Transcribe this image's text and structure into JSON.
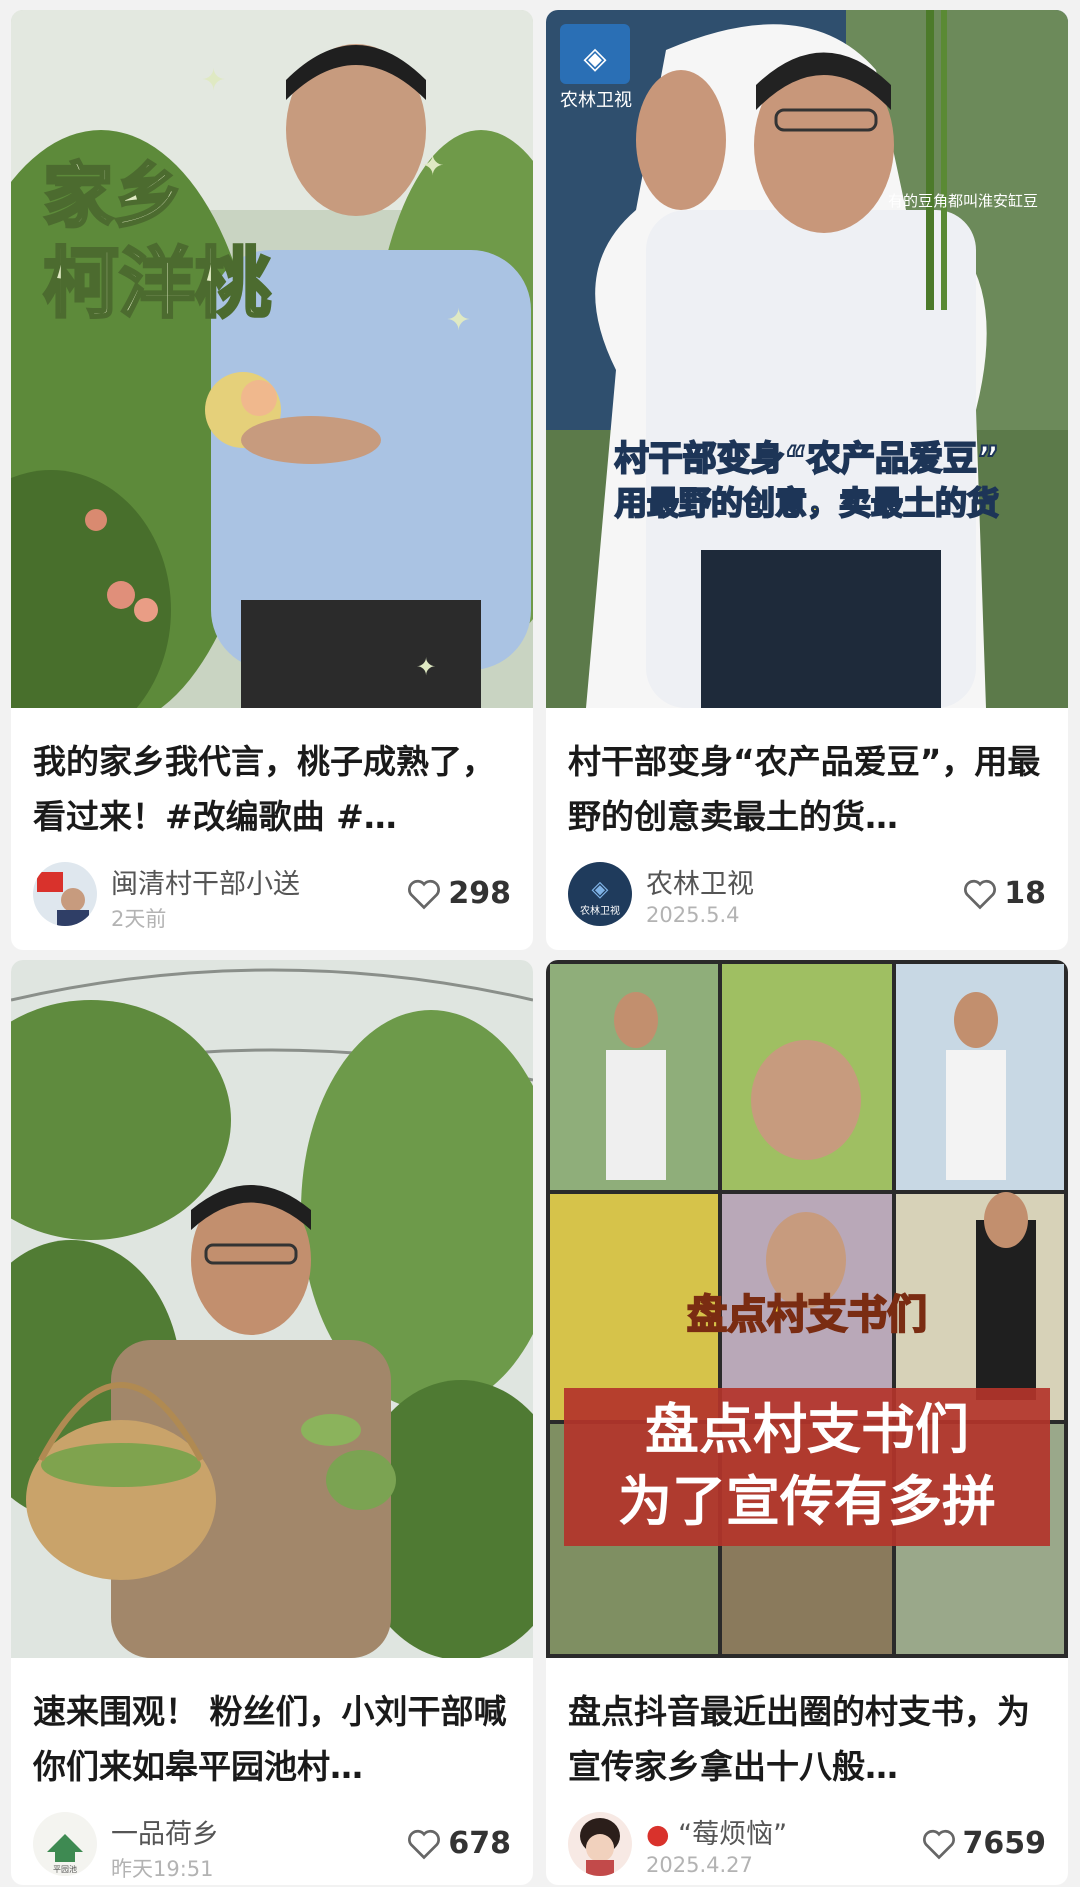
{
  "cards": [
    {
      "overlay_lines": [
        "家乡",
        "柯洋桃"
      ],
      "title": "我的家乡我代言，桃子成熟了，看过来！#改编歌曲 #…",
      "author": "闽清村干部小送",
      "date": "2天前",
      "likes": "298"
    },
    {
      "channel_logo_text": "农林卫视",
      "corner_caption": "有的豆角都叫淮安缸豆",
      "overlay_line1": "村干部变身“农产品爱豆”",
      "overlay_line2": "用最野的创意，卖最土的货",
      "title": "村干部变身“农产品爱豆”，用最野的创意卖最土的货…",
      "author": "农林卫视",
      "date": "2025.5.4",
      "likes": "18"
    },
    {
      "title": "速来围观！ 粉丝们，小刘干部喊你们来如皋平园池村…",
      "author": "一品荷乡",
      "date": "昨天19:51",
      "likes": "678"
    },
    {
      "overlay_small": "盘点村支书们",
      "overlay_line1": "盘点村支书们",
      "overlay_line2": "为了宣传有多拼",
      "title": "盘点抖音最近出圈的村支书，为宣传家乡拿出十八般…",
      "author": "“莓烦恼”",
      "author_prefix_icon": "balloon-icon",
      "date": "2025.4.27",
      "likes": "7659"
    }
  ],
  "colors": {
    "title": "#1a1a1a",
    "author": "#555555",
    "date": "#b3b3b3",
    "likes": "#333333",
    "yellow_text": "#ffe23a",
    "red_band": "#b3342a"
  }
}
